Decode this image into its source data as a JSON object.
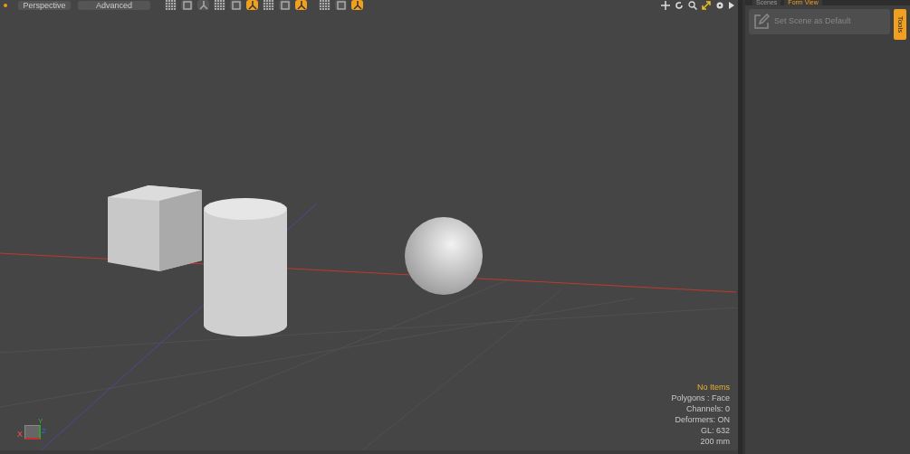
{
  "viewport": {
    "view_menu": "Perspective",
    "style_menu": "Advanced",
    "toolbar": [
      {
        "selected": false
      },
      {
        "selected": false
      },
      {
        "selected": false
      },
      {
        "selected": false
      },
      {
        "selected": false
      },
      {
        "selected": true
      },
      {
        "selected": false
      },
      {
        "selected": false
      },
      {
        "selected": true
      },
      {
        "selected": false
      },
      {
        "selected": false
      },
      {
        "selected": true
      }
    ],
    "info": [
      {
        "kind": "highlight",
        "text": "No Items"
      },
      {
        "kind": "plain",
        "text": "Polygons : Face"
      },
      {
        "kind": "plain",
        "text": "Channels: 0"
      },
      {
        "kind": "plain",
        "text": "Deformers: ON"
      },
      {
        "kind": "plain",
        "text": "GL: 632"
      },
      {
        "kind": "plain",
        "text": "200 mm"
      }
    ],
    "axis_labels": [
      "X",
      "Y",
      "Z"
    ]
  },
  "panel": {
    "tabs": [
      {
        "label": "Scenes",
        "selected": false
      },
      {
        "label": "Form View",
        "selected": true
      }
    ],
    "button": "Set Scene as Default",
    "side_tab": "Tools"
  }
}
